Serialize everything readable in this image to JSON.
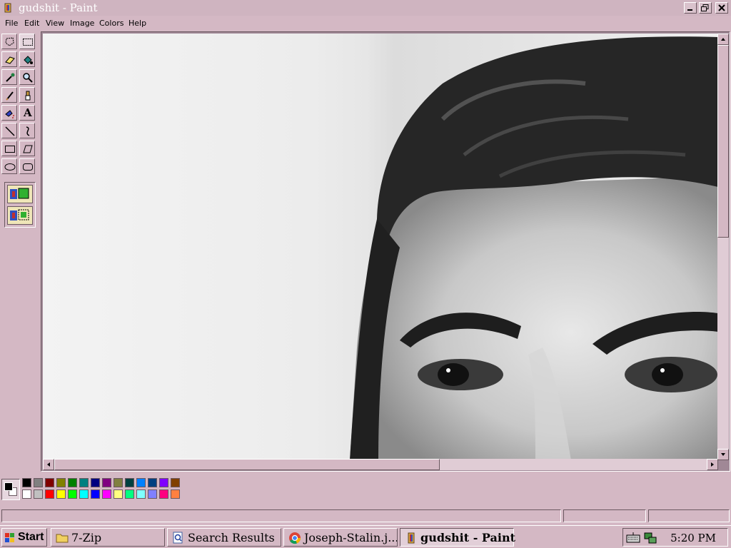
{
  "window": {
    "title": "gudshit - Paint"
  },
  "menu": [
    "File",
    "Edit",
    "View",
    "Image",
    "Colors",
    "Help"
  ],
  "tools": [
    {
      "name": "free-form-select-tool"
    },
    {
      "name": "rect-select-tool"
    },
    {
      "name": "eraser-tool"
    },
    {
      "name": "fill-bucket-tool"
    },
    {
      "name": "color-picker-tool"
    },
    {
      "name": "magnifier-tool"
    },
    {
      "name": "pencil-tool"
    },
    {
      "name": "brush-tool"
    },
    {
      "name": "airbrush-tool"
    },
    {
      "name": "text-tool"
    },
    {
      "name": "line-tool"
    },
    {
      "name": "curve-tool"
    },
    {
      "name": "rectangle-tool"
    },
    {
      "name": "polygon-tool"
    },
    {
      "name": "ellipse-tool"
    },
    {
      "name": "rounded-rect-tool"
    }
  ],
  "text_tool_glyph": "A",
  "canvas": {
    "content": "grayscale-portrait-photo"
  },
  "palette": {
    "foreground": "#000000",
    "background": "#ffffff",
    "top_row": [
      "#000000",
      "#808080",
      "#800000",
      "#808000",
      "#008000",
      "#008080",
      "#000080",
      "#800080",
      "#808040",
      "#004040",
      "#0080ff",
      "#004080",
      "#8000ff",
      "#804000"
    ],
    "bottom_row": [
      "#ffffff",
      "#c0c0c0",
      "#ff0000",
      "#ffff00",
      "#00ff00",
      "#00ffff",
      "#0000ff",
      "#ff00ff",
      "#ffff80",
      "#00ff80",
      "#80ffff",
      "#8080ff",
      "#ff0080",
      "#ff8040"
    ]
  },
  "taskbar": {
    "start": "Start",
    "buttons": [
      {
        "label": "7-Zip",
        "icon": "folder-icon"
      },
      {
        "label": "Search Results",
        "icon": "search-results-icon"
      },
      {
        "label": "Joseph-Stalin.j...",
        "icon": "chrome-icon"
      },
      {
        "label": "gudshit - Paint",
        "icon": "paint-icon",
        "active": true
      }
    ],
    "clock": "5:20 PM"
  }
}
